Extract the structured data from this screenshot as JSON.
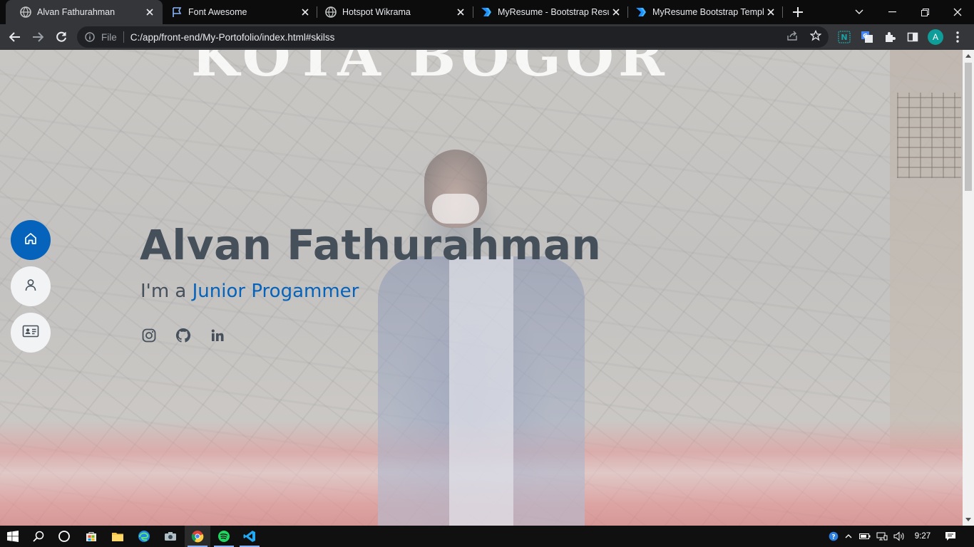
{
  "browser": {
    "tabs": [
      {
        "title": "Alvan Fathurahman",
        "icon": "globe-icon",
        "active": true
      },
      {
        "title": "Font Awesome",
        "icon": "flag-icon",
        "active": false
      },
      {
        "title": "Hotspot Wikrama",
        "icon": "globe-icon",
        "active": false
      },
      {
        "title": "MyResume - Bootstrap Resum",
        "icon": "bootstrapmade-icon",
        "active": false
      },
      {
        "title": "MyResume Bootstrap Templa",
        "icon": "bootstrapmade-icon",
        "active": false
      }
    ],
    "address": {
      "scheme_label": "File",
      "url": "C:/app/front-end/My-Portofolio/index.html#skilss"
    },
    "profile_initial": "A"
  },
  "page": {
    "background_sign": "KOTA BOGOR",
    "hero": {
      "name": "Alvan Fathurahman",
      "intro": "I'm a",
      "role": "Junior Progammer"
    },
    "socials": [
      {
        "name": "instagram-icon"
      },
      {
        "name": "github-icon"
      },
      {
        "name": "linkedin-icon"
      }
    ],
    "nav": [
      {
        "name": "home-icon",
        "active": true
      },
      {
        "name": "user-icon",
        "active": false
      },
      {
        "name": "id-card-icon",
        "active": false
      }
    ]
  },
  "taskbar": {
    "time": "9:27",
    "apps": [
      "start-icon",
      "search-icon",
      "task-view-icon",
      "store-icon",
      "file-explorer-icon",
      "edge-icon",
      "camera-icon",
      "chrome-icon",
      "spotify-icon",
      "vscode-icon"
    ]
  },
  "colors": {
    "accent": "#0563bb",
    "heading": "#45505b",
    "tab_active": "#35363a",
    "tabstrip": "#0c0c0d"
  }
}
